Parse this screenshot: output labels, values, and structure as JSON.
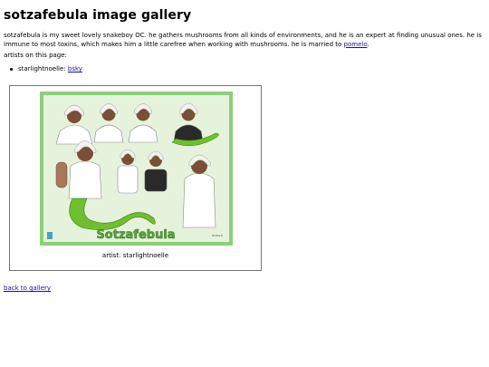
{
  "page": {
    "title": "sotzafebula image gallery",
    "intro_text": "sotzafebula is my sweet lovely snakeboy OC. he gathers mushrooms from all kinds of environments, and he is an expert at finding unusual ones. he is immune to most toxins, which makes him a little carefree when working with mushrooms. he is married to ",
    "intro_link": "pomelo",
    "intro_end": "."
  },
  "artists": {
    "label": "artists on this page:",
    "items": [
      {
        "name": "starlightnoelle: ",
        "link": "bsky"
      }
    ]
  },
  "gallery": {
    "image": {
      "banner_text": "Sotzafebula",
      "signature": "NOELLE",
      "colors": {
        "frame": "#8ccf7a",
        "bg": "#e6f3dc",
        "hair": "#f2f2ee",
        "skin": "#7a4f36",
        "snake": "#6fbf2e"
      }
    },
    "caption": "artist: starlightnoelle"
  },
  "footer": {
    "back_link": "back to gallery"
  }
}
